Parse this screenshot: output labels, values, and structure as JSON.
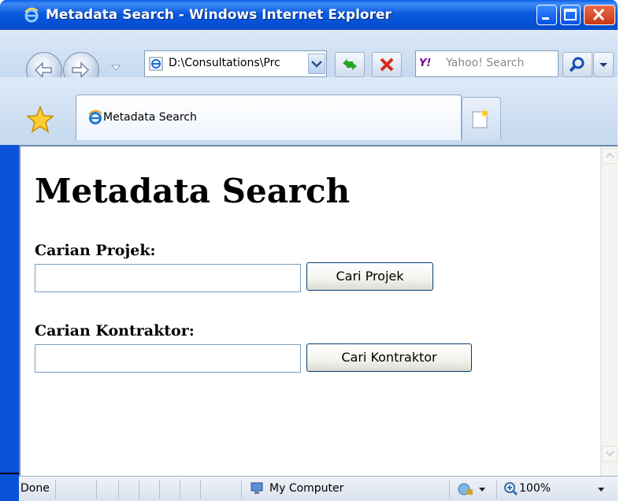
{
  "window": {
    "title": "Metadata Search - Windows Internet Explorer"
  },
  "navigation": {
    "address": "D:\\Consultations\\Prc",
    "search_placeholder": "Yahoo! Search",
    "search_provider_icon": "Y!"
  },
  "tabs": [
    {
      "label": "Metadata Search",
      "active": true
    }
  ],
  "page": {
    "heading": "Metadata Search",
    "project_label": "Carian Projek:",
    "project_input_value": "",
    "project_button": "Cari Projek",
    "contractor_label": "Carian Kontraktor:",
    "contractor_input_value": "",
    "contractor_button": "Cari Kontraktor"
  },
  "status": {
    "text": "Done",
    "zone": "My Computer",
    "zoom": "100%"
  },
  "icons": {
    "window_icon": "ie-logo-icon",
    "back": "back-arrow-icon",
    "forward": "forward-arrow-icon",
    "refresh": "refresh-icon",
    "stop": "stop-icon",
    "search": "magnifier-icon",
    "favorites": "star-icon",
    "new_tab": "new-tab-icon",
    "zone": "computer-icon",
    "zoom": "zoom-icon"
  },
  "colors": {
    "titlebar": "#0a5fe6",
    "close_button": "#c73816",
    "chrome": "#c6d9ef"
  }
}
